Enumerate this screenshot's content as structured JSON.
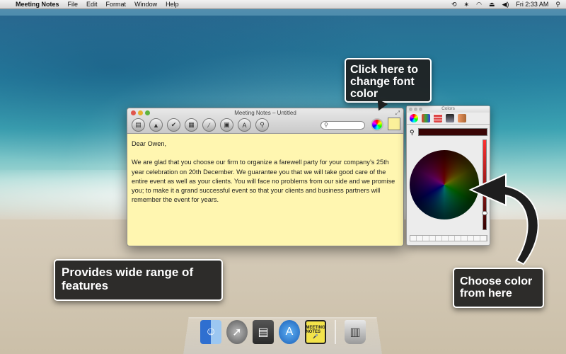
{
  "menubar": {
    "app_name": "Meeting Notes",
    "items": [
      "File",
      "Edit",
      "Format",
      "Window",
      "Help"
    ],
    "clock": "Fri 2:33 AM"
  },
  "window": {
    "title": "Meeting Notes – Untitled",
    "toolbar_icons": [
      "document-icon",
      "up-arrow-icon",
      "checkmark-icon",
      "stack-icon",
      "pen-icon",
      "photo-icon",
      "font-icon",
      "microphone-icon"
    ],
    "note": {
      "greeting": "Dear Owen,",
      "body": "We are glad that you choose our firm to organize a farewell party for your company’s 25th year celebration on 20th December. We guarantee you that we will take good care of the entire event as well as your clients. You will face no problems from our side and we promise you; to make it a grand successful event so that your clients and business partners will remember the event for years."
    },
    "note_background_color": "#fff6b0"
  },
  "colors_panel": {
    "title": "Colors",
    "selected_color": "#3a0505"
  },
  "callouts": {
    "font_color": "Click here to change font color",
    "features": "Provides wide range of features",
    "choose_color": "Choose color from here"
  },
  "dock": {
    "items": [
      "finder-icon",
      "launchpad-icon",
      "dashboard-icon",
      "app-store-icon",
      "meeting-notes-icon",
      "trash-icon"
    ],
    "meeting_notes_label": "MEETING NOTES"
  }
}
